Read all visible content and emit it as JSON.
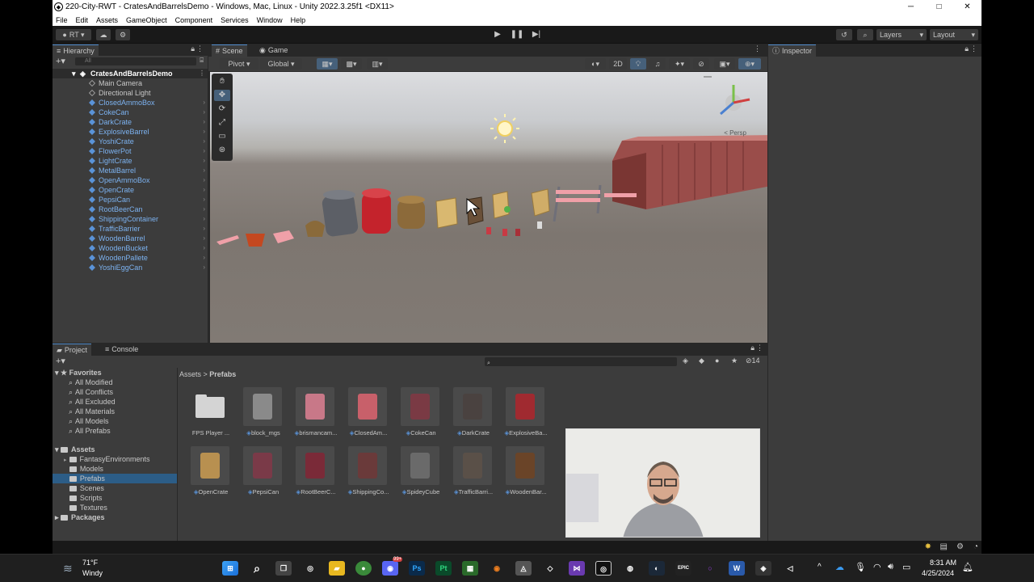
{
  "window": {
    "title": "220-City-RWT - CratesAndBarrelsDemo - Windows, Mac, Linux - Unity 2022.3.25f1 <DX11>",
    "minimize": "─",
    "maximize": "□",
    "close": "✕"
  },
  "menu": [
    "File",
    "Edit",
    "Assets",
    "GameObject",
    "Component",
    "Services",
    "Window",
    "Help"
  ],
  "toolbar": {
    "account": "RT ▾",
    "layers": "Layers",
    "layout": "Layout"
  },
  "hierarchy": {
    "tab": "Hierarchy",
    "search_placeholder": "All",
    "scene": "CratesAndBarrelsDemo",
    "items": [
      {
        "label": "Main Camera",
        "prefab": false
      },
      {
        "label": "Directional Light",
        "prefab": false
      },
      {
        "label": "ClosedAmmoBox",
        "prefab": true
      },
      {
        "label": "CokeCan",
        "prefab": true
      },
      {
        "label": "DarkCrate",
        "prefab": true
      },
      {
        "label": "ExplosiveBarrel",
        "prefab": true
      },
      {
        "label": "YoshiCrate",
        "prefab": true
      },
      {
        "label": "FlowerPot",
        "prefab": true
      },
      {
        "label": "LightCrate",
        "prefab": true
      },
      {
        "label": "MetalBarrel",
        "prefab": true
      },
      {
        "label": "OpenAmmoBox",
        "prefab": true
      },
      {
        "label": "OpenCrate",
        "prefab": true
      },
      {
        "label": "PepsiCan",
        "prefab": true
      },
      {
        "label": "RootBeerCan",
        "prefab": true
      },
      {
        "label": "ShippingContainer",
        "prefab": true
      },
      {
        "label": "TrafficBarrier",
        "prefab": true
      },
      {
        "label": "WoodenBarrel",
        "prefab": true
      },
      {
        "label": "WoodenBucket",
        "prefab": true
      },
      {
        "label": "WoodenPallete",
        "prefab": true
      },
      {
        "label": "YoshiEggCan",
        "prefab": true
      }
    ]
  },
  "scene_view": {
    "tabs": [
      "Scene",
      "Game"
    ],
    "pivot": "Pivot",
    "global": "Global",
    "mode_2d": "2D",
    "persp": "< Persp"
  },
  "inspector": {
    "tab": "Inspector"
  },
  "project": {
    "tabs": [
      "Project",
      "Console"
    ],
    "hidden_count": "14",
    "breadcrumb": [
      "Assets",
      "Prefabs"
    ],
    "favorites": {
      "title": "Favorites",
      "items": [
        "All Modified",
        "All Conflicts",
        "All Excluded",
        "All Materials",
        "All Models",
        "All Prefabs"
      ]
    },
    "assets": {
      "title": "Assets",
      "items": [
        "FantasyEnvironments",
        "Models",
        "Prefabs",
        "Scenes",
        "Scripts",
        "Textures"
      ]
    },
    "packages": "Packages",
    "grid_row1": [
      {
        "label": "FPS Player ...",
        "prefab": false
      },
      {
        "label": "block_mgs",
        "prefab": true
      },
      {
        "label": "brismancam...",
        "prefab": true
      },
      {
        "label": "ClosedAm...",
        "prefab": true
      },
      {
        "label": "CokeCan",
        "prefab": true
      },
      {
        "label": "DarkCrate",
        "prefab": true
      },
      {
        "label": "ExplosiveBa...",
        "prefab": true
      }
    ],
    "grid_row2": [
      {
        "label": "OpenCrate",
        "prefab": true
      },
      {
        "label": "PepsiCan",
        "prefab": true
      },
      {
        "label": "RootBeerC...",
        "prefab": true
      },
      {
        "label": "ShippingCo...",
        "prefab": true
      },
      {
        "label": "SpideyCube",
        "prefab": true
      },
      {
        "label": "TrafficBarri...",
        "prefab": true
      },
      {
        "label": "WoodenBar...",
        "prefab": true
      }
    ]
  },
  "taskbar": {
    "weather_temp": "71°F",
    "weather_text": "Windy",
    "time": "8:31 AM",
    "date": "4/25/2024",
    "badge": "99+"
  }
}
